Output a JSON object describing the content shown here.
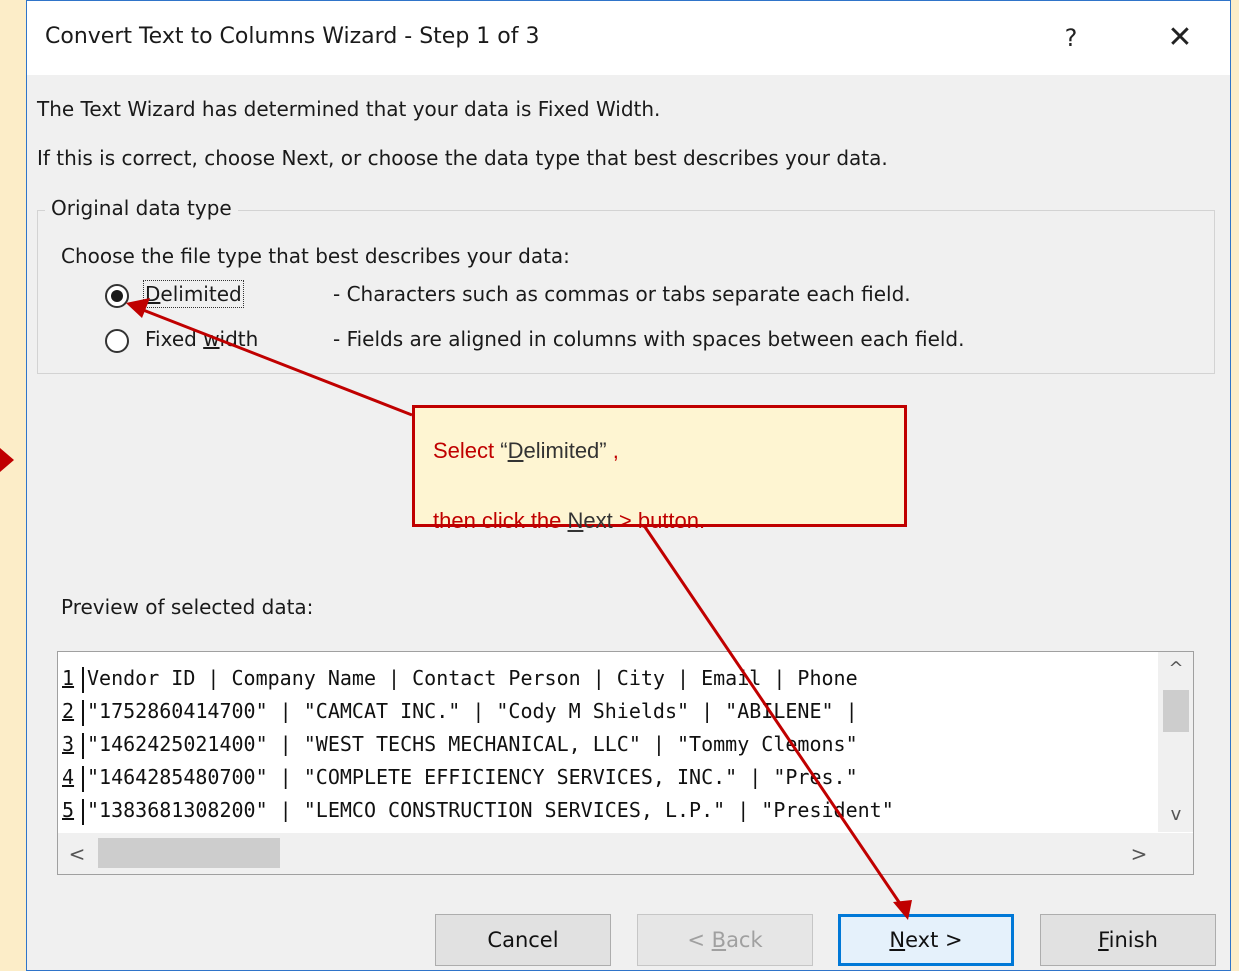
{
  "dialog": {
    "title": "Convert Text to Columns Wizard - Step 1 of 3",
    "help_label": "?",
    "close_label": "✕"
  },
  "intro": {
    "line1": "The Text Wizard has determined that your data is Fixed Width.",
    "line2": "If this is correct, choose Next, or choose the data type that best describes your data."
  },
  "data_type": {
    "legend": "Original data type",
    "prompt": "Choose the file type that best describes your data:",
    "options": [
      {
        "label_pre": "",
        "label_key": "D",
        "label_post": "elimited",
        "description": "- Characters such as commas or tabs separate each field.",
        "selected": true
      },
      {
        "label_pre": "Fixed ",
        "label_key": "w",
        "label_post": "idth",
        "description": "- Fields are aligned in columns with spaces between each field.",
        "selected": false
      }
    ]
  },
  "callout": {
    "line1_a": "Select ",
    "line1_q1": "“",
    "line1_key": "D",
    "line1_b": "elimited",
    "line1_q2": "”",
    "line1_c": " ,",
    "line2_a": "then click the ",
    "line2_key": "N",
    "line2_b": "ext",
    "line2_c": " > button."
  },
  "preview": {
    "label": "Preview of selected data:",
    "rows": [
      {
        "num": "1",
        "text": "Vendor ID | Company Name | Contact Person | City | Email | Phone"
      },
      {
        "num": "2",
        "text": "\"1752860414700\" | \"CAMCAT INC.\" | \"Cody M Shields\" | \"ABILENE\" |"
      },
      {
        "num": "3",
        "text": "\"1462425021400\" | \"WEST TECHS MECHANICAL, LLC\" | \"Tommy Clemons\""
      },
      {
        "num": "4",
        "text": "\"1464285480700\" | \"COMPLETE EFFICIENCY SERVICES, INC.\" | \"Pres.\""
      },
      {
        "num": "5",
        "text": "\"1383681308200\" | \"LEMCO CONSTRUCTION SERVICES, L.P.\" | \"President\""
      }
    ],
    "scroll_up": "^",
    "scroll_down": "v",
    "scroll_left": "<",
    "scroll_right": ">"
  },
  "buttons": {
    "cancel": "Cancel",
    "back_key": "B",
    "back_pre": "< ",
    "back_post": "ack",
    "next_key": "N",
    "next_post": "ext >",
    "finish_key": "F",
    "finish_post": "inish"
  },
  "colors": {
    "annotation": "#c00000",
    "default_button_border": "#0078d7",
    "page_background": "#fcedc8"
  }
}
